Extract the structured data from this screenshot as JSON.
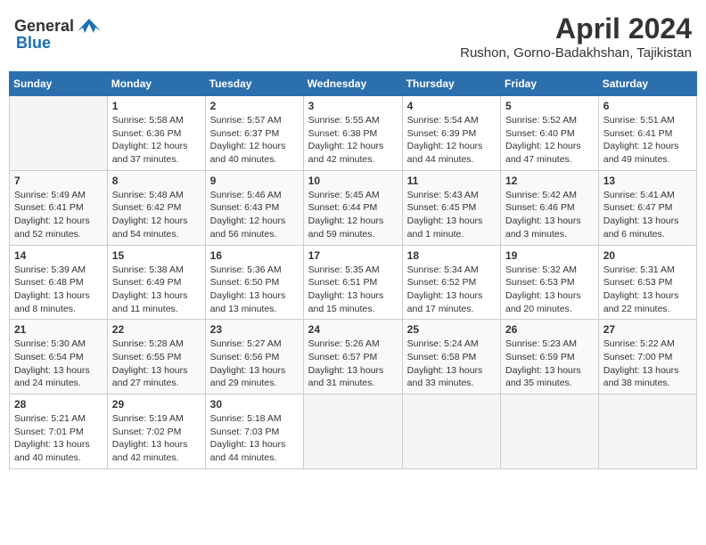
{
  "header": {
    "logo_general": "General",
    "logo_blue": "Blue",
    "title": "April 2024",
    "subtitle": "Rushon, Gorno-Badakhshan, Tajikistan"
  },
  "weekdays": [
    "Sunday",
    "Monday",
    "Tuesday",
    "Wednesday",
    "Thursday",
    "Friday",
    "Saturday"
  ],
  "weeks": [
    [
      {
        "day": "",
        "info": ""
      },
      {
        "day": "1",
        "info": "Sunrise: 5:58 AM\nSunset: 6:36 PM\nDaylight: 12 hours\nand 37 minutes."
      },
      {
        "day": "2",
        "info": "Sunrise: 5:57 AM\nSunset: 6:37 PM\nDaylight: 12 hours\nand 40 minutes."
      },
      {
        "day": "3",
        "info": "Sunrise: 5:55 AM\nSunset: 6:38 PM\nDaylight: 12 hours\nand 42 minutes."
      },
      {
        "day": "4",
        "info": "Sunrise: 5:54 AM\nSunset: 6:39 PM\nDaylight: 12 hours\nand 44 minutes."
      },
      {
        "day": "5",
        "info": "Sunrise: 5:52 AM\nSunset: 6:40 PM\nDaylight: 12 hours\nand 47 minutes."
      },
      {
        "day": "6",
        "info": "Sunrise: 5:51 AM\nSunset: 6:41 PM\nDaylight: 12 hours\nand 49 minutes."
      }
    ],
    [
      {
        "day": "7",
        "info": "Sunrise: 5:49 AM\nSunset: 6:41 PM\nDaylight: 12 hours\nand 52 minutes."
      },
      {
        "day": "8",
        "info": "Sunrise: 5:48 AM\nSunset: 6:42 PM\nDaylight: 12 hours\nand 54 minutes."
      },
      {
        "day": "9",
        "info": "Sunrise: 5:46 AM\nSunset: 6:43 PM\nDaylight: 12 hours\nand 56 minutes."
      },
      {
        "day": "10",
        "info": "Sunrise: 5:45 AM\nSunset: 6:44 PM\nDaylight: 12 hours\nand 59 minutes."
      },
      {
        "day": "11",
        "info": "Sunrise: 5:43 AM\nSunset: 6:45 PM\nDaylight: 13 hours\nand 1 minute."
      },
      {
        "day": "12",
        "info": "Sunrise: 5:42 AM\nSunset: 6:46 PM\nDaylight: 13 hours\nand 3 minutes."
      },
      {
        "day": "13",
        "info": "Sunrise: 5:41 AM\nSunset: 6:47 PM\nDaylight: 13 hours\nand 6 minutes."
      }
    ],
    [
      {
        "day": "14",
        "info": "Sunrise: 5:39 AM\nSunset: 6:48 PM\nDaylight: 13 hours\nand 8 minutes."
      },
      {
        "day": "15",
        "info": "Sunrise: 5:38 AM\nSunset: 6:49 PM\nDaylight: 13 hours\nand 11 minutes."
      },
      {
        "day": "16",
        "info": "Sunrise: 5:36 AM\nSunset: 6:50 PM\nDaylight: 13 hours\nand 13 minutes."
      },
      {
        "day": "17",
        "info": "Sunrise: 5:35 AM\nSunset: 6:51 PM\nDaylight: 13 hours\nand 15 minutes."
      },
      {
        "day": "18",
        "info": "Sunrise: 5:34 AM\nSunset: 6:52 PM\nDaylight: 13 hours\nand 17 minutes."
      },
      {
        "day": "19",
        "info": "Sunrise: 5:32 AM\nSunset: 6:53 PM\nDaylight: 13 hours\nand 20 minutes."
      },
      {
        "day": "20",
        "info": "Sunrise: 5:31 AM\nSunset: 6:53 PM\nDaylight: 13 hours\nand 22 minutes."
      }
    ],
    [
      {
        "day": "21",
        "info": "Sunrise: 5:30 AM\nSunset: 6:54 PM\nDaylight: 13 hours\nand 24 minutes."
      },
      {
        "day": "22",
        "info": "Sunrise: 5:28 AM\nSunset: 6:55 PM\nDaylight: 13 hours\nand 27 minutes."
      },
      {
        "day": "23",
        "info": "Sunrise: 5:27 AM\nSunset: 6:56 PM\nDaylight: 13 hours\nand 29 minutes."
      },
      {
        "day": "24",
        "info": "Sunrise: 5:26 AM\nSunset: 6:57 PM\nDaylight: 13 hours\nand 31 minutes."
      },
      {
        "day": "25",
        "info": "Sunrise: 5:24 AM\nSunset: 6:58 PM\nDaylight: 13 hours\nand 33 minutes."
      },
      {
        "day": "26",
        "info": "Sunrise: 5:23 AM\nSunset: 6:59 PM\nDaylight: 13 hours\nand 35 minutes."
      },
      {
        "day": "27",
        "info": "Sunrise: 5:22 AM\nSunset: 7:00 PM\nDaylight: 13 hours\nand 38 minutes."
      }
    ],
    [
      {
        "day": "28",
        "info": "Sunrise: 5:21 AM\nSunset: 7:01 PM\nDaylight: 13 hours\nand 40 minutes."
      },
      {
        "day": "29",
        "info": "Sunrise: 5:19 AM\nSunset: 7:02 PM\nDaylight: 13 hours\nand 42 minutes."
      },
      {
        "day": "30",
        "info": "Sunrise: 5:18 AM\nSunset: 7:03 PM\nDaylight: 13 hours\nand 44 minutes."
      },
      {
        "day": "",
        "info": ""
      },
      {
        "day": "",
        "info": ""
      },
      {
        "day": "",
        "info": ""
      },
      {
        "day": "",
        "info": ""
      }
    ]
  ]
}
